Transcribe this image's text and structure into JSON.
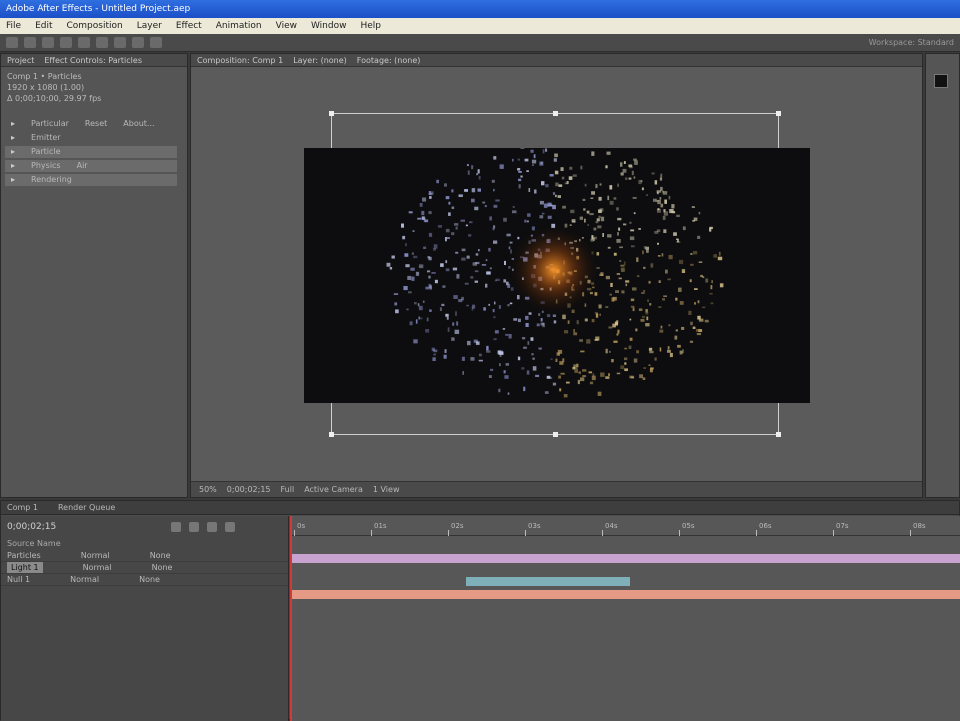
{
  "window": {
    "title": "Adobe After Effects - Untitled Project.aep"
  },
  "menu": [
    "File",
    "Edit",
    "Composition",
    "Layer",
    "Effect",
    "Animation",
    "View",
    "Window",
    "Help"
  ],
  "toolbar": {
    "workspace": "Workspace: Standard"
  },
  "project": {
    "tabs": [
      "Project",
      "Effect Controls: Particles"
    ],
    "info": [
      "Comp 1 • Particles",
      "1920 x 1080 (1.00)",
      "Δ 0;00;10;00, 29.97 fps"
    ],
    "rows": [
      {
        "name": "Particular",
        "value": "Reset",
        "extra": "About..."
      },
      {
        "name": "Emitter",
        "value": "",
        "extra": ""
      },
      {
        "name": "Particle",
        "value": "",
        "extra": ""
      },
      {
        "name": "Physics",
        "value": "Air",
        "extra": ""
      },
      {
        "name": "Rendering",
        "value": "",
        "extra": ""
      }
    ]
  },
  "viewer": {
    "tabs": [
      "Composition: Comp 1",
      "Layer: (none)",
      "Footage: (none)"
    ],
    "footer": [
      "50%",
      "0;00;02;15",
      "Full",
      "Active Camera",
      "1 View"
    ]
  },
  "timeline": {
    "tabs": [
      "Comp 1",
      "Render Queue"
    ],
    "timecode": "0;00;02;15",
    "search": "Source Name",
    "layers": [
      {
        "name": "Particles",
        "mode": "Normal",
        "parent": "None"
      },
      {
        "name": "Light 1",
        "mode": "Normal",
        "parent": "None"
      },
      {
        "name": "Null 1",
        "mode": "Normal",
        "parent": "None"
      }
    ],
    "ruler": [
      "0s",
      "01s",
      "02s",
      "03s",
      "04s",
      "05s",
      "06s",
      "07s",
      "08s"
    ]
  },
  "colors": {
    "bar_top": "#c8a3cf",
    "bar_mid": "#7fb0ba",
    "bar_bottom": "#e59a86",
    "glow_core": "#ff9a2a"
  }
}
